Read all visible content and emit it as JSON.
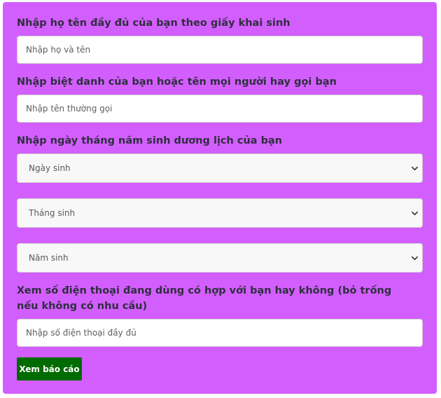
{
  "form": {
    "full_name": {
      "label": "Nhập họ tên đầy đủ của bạn theo giấy khai sinh",
      "placeholder": "Nhập họ và tên"
    },
    "nickname": {
      "label": "Nhập biệt danh của bạn hoặc tên mọi người hay gọi bạn",
      "placeholder": "Nhập tên thường gọi"
    },
    "birth_date": {
      "label": "Nhập ngày tháng năm sinh dương lịch của bạn",
      "day_select": "Ngày sinh",
      "month_select": "Tháng sinh",
      "year_select": "Năm sinh"
    },
    "phone": {
      "label": "Xem số điện thoại đang dùng có hợp với bạn hay không (bỏ trống nếu không có nhu cầu)",
      "placeholder": "Nhập số điện thoại đầy đủ"
    },
    "submit_label": "Xem báo cáo"
  },
  "colors": {
    "panel": "#d35efe",
    "button": "#006b00"
  },
  "icons": {
    "select_arrow": "chevron-down-icon"
  }
}
